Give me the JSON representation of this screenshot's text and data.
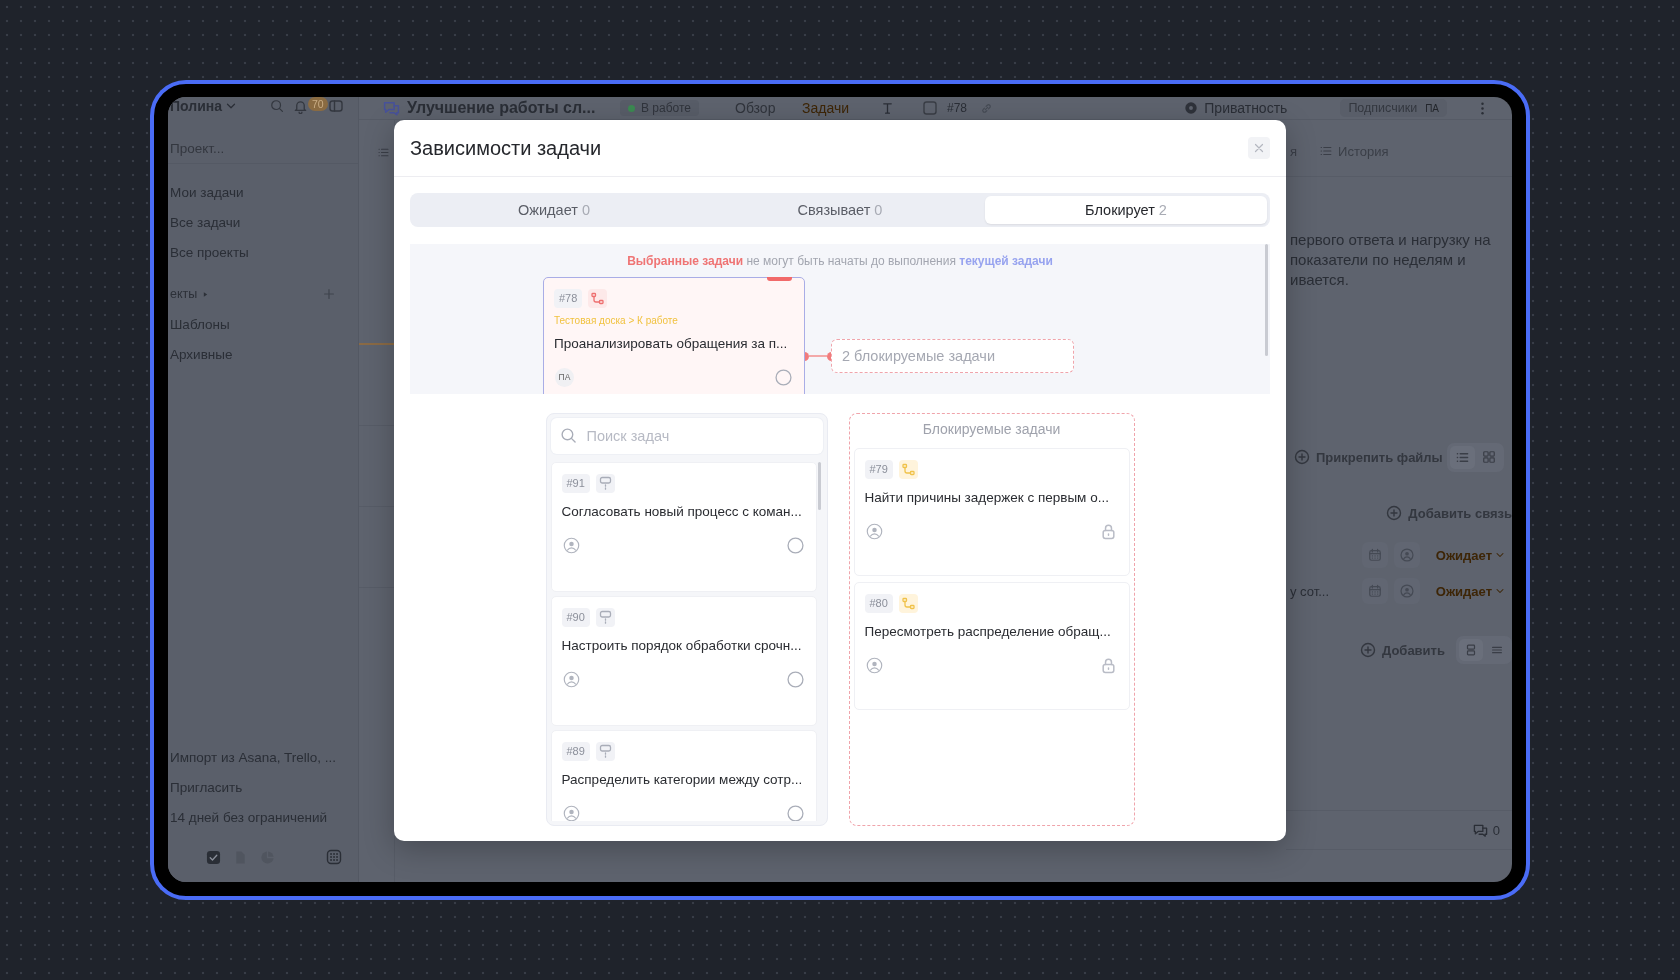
{
  "app": {
    "sidebar": {
      "user": "Полина",
      "notification_count": "70",
      "project_search": "Проект...",
      "nav_items": [
        "Мои задачи",
        "Все задачи",
        "Все проекты"
      ],
      "section_label": "екты",
      "section_items": [
        "Шаблоны",
        "Архивные"
      ],
      "footer_links": [
        "Импорт из Asana, Trello, ...",
        "Пригласить",
        "14 дней без ограничений"
      ]
    },
    "header": {
      "project_title": "Улучшение работы сл...",
      "status": "В работе",
      "tabs": [
        {
          "label": "Обзор",
          "selected": false
        },
        {
          "label": "Задачи",
          "selected": true
        }
      ],
      "task_number": "#78",
      "privacy": "Приватность",
      "subscribers": "Подписчики",
      "subscriber_initials": "ПА"
    },
    "task_panel": {
      "tab_partial": "я",
      "history_tab": "История",
      "description_lines": [
        "первого ответа и нагрузку на",
        "показатели по неделям и",
        "ивается."
      ],
      "attach_button": "Прикрепить файлы",
      "add_link_button": "Добавить связь",
      "links": [
        {
          "status": "Ожидает"
        },
        {
          "title": "у сот...",
          "status": "Ожидает"
        }
      ],
      "add_button": "Добавить",
      "comment_count": "0"
    }
  },
  "modal": {
    "title": "Зависимости задачи",
    "tabs": [
      {
        "label": "Ожидает",
        "count": "0",
        "selected": false
      },
      {
        "label": "Связывает",
        "count": "0",
        "selected": false
      },
      {
        "label": "Блокирует",
        "count": "2",
        "selected": true
      }
    ],
    "notice": {
      "selected_part": "Выбранные задачи",
      "middle": "не могут быть начаты до выполнения",
      "current_part": "текущей задачи"
    },
    "current_task": {
      "number": "#78",
      "path": "Тестовая доска > К работе",
      "title": "Проанализировать обращения за п...",
      "assignee": "ПА"
    },
    "blocked_summary": "2 блокируемые задачи",
    "search": {
      "placeholder": "Поиск задач"
    },
    "available_tasks": [
      {
        "number": "#91",
        "title": "Согласовать новый процесс с коман..."
      },
      {
        "number": "#90",
        "title": "Настроить порядок обработки срочн..."
      },
      {
        "number": "#89",
        "title": "Распределить категории между сотр..."
      }
    ],
    "blocked_column_title": "Блокируемые задачи",
    "blocked_tasks": [
      {
        "number": "#79",
        "title": "Найти причины задержек с первым о..."
      },
      {
        "number": "#80",
        "title": "Пересмотреть распределение обращ..."
      }
    ]
  }
}
